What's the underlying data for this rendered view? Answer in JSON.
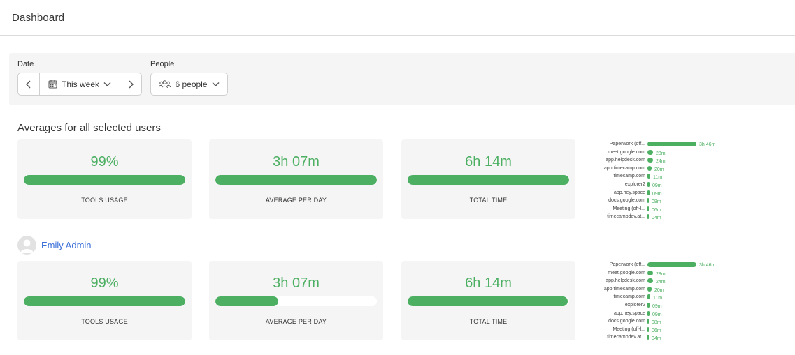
{
  "header": {
    "title": "Dashboard"
  },
  "filters": {
    "date_label": "Date",
    "date_value": "This week",
    "people_label": "People",
    "people_value": "6 people"
  },
  "averages": {
    "title": "Averages for all selected users",
    "cards": [
      {
        "value": "99%",
        "label": "TOOLS USAGE",
        "fill": 1.0
      },
      {
        "value": "3h 07m",
        "label": "AVERAGE PER DAY",
        "fill": 1.0
      },
      {
        "value": "6h 14m",
        "label": "TOTAL TIME",
        "fill": 1.0
      }
    ],
    "apps": [
      {
        "name": "Paperwork (off...",
        "time": "3h 46m",
        "fraction": 1.0
      },
      {
        "name": "meet.google.com",
        "time": "28m",
        "fraction": 0.12
      },
      {
        "name": "app.helpdesk.com",
        "time": "24m",
        "fraction": 0.11
      },
      {
        "name": "app.timecamp.com",
        "time": "20m",
        "fraction": 0.09
      },
      {
        "name": "timecamp.com",
        "time": "11m",
        "fraction": 0.05
      },
      {
        "name": "explorer2",
        "time": "09m",
        "fraction": 0.04
      },
      {
        "name": "app.hey.space",
        "time": "09m",
        "fraction": 0.04
      },
      {
        "name": "docs.google.com",
        "time": "08m",
        "fraction": 0.035
      },
      {
        "name": "Meeting (off-l...",
        "time": "06m",
        "fraction": 0.027
      },
      {
        "name": "timecampdev.at...",
        "time": "04m",
        "fraction": 0.02
      }
    ]
  },
  "user": {
    "name": "Emily Admin",
    "cards": [
      {
        "value": "99%",
        "label": "TOOLS USAGE",
        "fill": 1.0
      },
      {
        "value": "3h 07m",
        "label": "AVERAGE PER DAY",
        "fill": 0.39
      },
      {
        "value": "6h 14m",
        "label": "TOTAL TIME",
        "fill": 0.99
      }
    ],
    "apps": [
      {
        "name": "Paperwork (off...",
        "time": "3h 46m",
        "fraction": 1.0
      },
      {
        "name": "meet.google.com",
        "time": "28m",
        "fraction": 0.12
      },
      {
        "name": "app.helpdesk.com",
        "time": "24m",
        "fraction": 0.11
      },
      {
        "name": "app.timecamp.com",
        "time": "20m",
        "fraction": 0.09
      },
      {
        "name": "timecamp.com",
        "time": "11m",
        "fraction": 0.05
      },
      {
        "name": "explorer2",
        "time": "09m",
        "fraction": 0.04
      },
      {
        "name": "app.hey.space",
        "time": "09m",
        "fraction": 0.04
      },
      {
        "name": "docs.google.com",
        "time": "08m",
        "fraction": 0.035
      },
      {
        "name": "Meeting (off-l...",
        "time": "06m",
        "fraction": 0.027
      },
      {
        "name": "timecampdev.at...",
        "time": "04m",
        "fraction": 0.02
      }
    ]
  },
  "colors": {
    "accent": "#4caf62",
    "link": "#3a6fd8",
    "panel": "#f5f5f5"
  },
  "icons": [
    "chevron-left-icon",
    "calendar-icon",
    "chevron-down-icon",
    "chevron-right-icon",
    "people-icon",
    "user-avatar-icon"
  ]
}
